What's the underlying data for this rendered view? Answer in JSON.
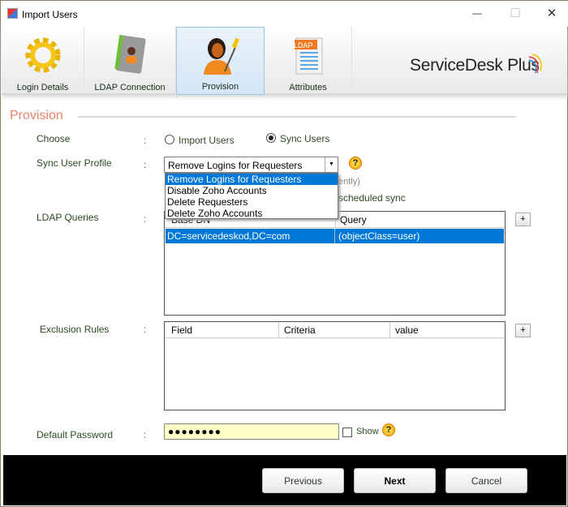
{
  "window": {
    "title": "Import Users",
    "minimize": "—",
    "maximize": "☐",
    "close": "✕"
  },
  "tabs": [
    {
      "label": "Login Details",
      "icon": "gear-icon"
    },
    {
      "label": "LDAP Connection",
      "icon": "address-book-icon"
    },
    {
      "label": "Provision",
      "icon": "user-tools-icon",
      "selected": true
    },
    {
      "label": "Attributes",
      "icon": "ldap-document-icon",
      "badge": "LDAP"
    }
  ],
  "brand": "ServiceDesk Plus",
  "section_title": "Provision",
  "form": {
    "colon": ":",
    "choose": {
      "label": "Choose",
      "options": [
        "Import Users",
        "Sync Users"
      ],
      "selected": "Sync Users"
    },
    "sync_profile": {
      "label": "Sync User Profile",
      "value": "Remove Logins for Requesters",
      "help": "?",
      "options": [
        "Remove Logins for Requesters",
        "Disable Zoho Accounts",
        "Delete Requesters",
        "Delete Zoho Accounts"
      ],
      "hidden_text_1": "ently)",
      "hidden_text_2": "scheduled sync"
    },
    "ldap_queries": {
      "label": "LDAP Queries",
      "columns": [
        "Base DN",
        "Query"
      ],
      "rows": [
        [
          "DC=servicedeskod,DC=com",
          "(objectClass=user)"
        ]
      ],
      "add": "+"
    },
    "exclusion_rules": {
      "label": "Exclusion Rules",
      "columns": [
        "Field",
        "Criteria",
        "value"
      ],
      "add": "+"
    },
    "default_password": {
      "label": "Default Password",
      "value": "●●●●●●●●",
      "show_label": "Show",
      "show_checked": false,
      "help": "?"
    }
  },
  "buttons": {
    "previous": "Previous",
    "next": "Next",
    "cancel": "Cancel"
  },
  "colors": {
    "accent": "#e8826a",
    "selection": "#0078d7",
    "label": "#2c4a22"
  }
}
